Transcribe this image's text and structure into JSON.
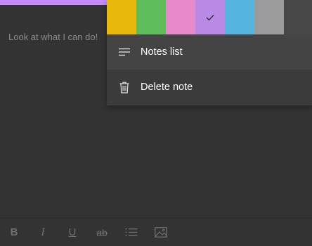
{
  "note": {
    "accent_color": "#c48bff",
    "body_text": "Look at what I can do!"
  },
  "menu": {
    "colors": [
      {
        "name": "yellow",
        "hex": "#e8b80a",
        "selected": false
      },
      {
        "name": "green",
        "hex": "#5fbd5b",
        "selected": false
      },
      {
        "name": "pink",
        "hex": "#e889c9",
        "selected": false
      },
      {
        "name": "purple",
        "hex": "#b98be6",
        "selected": true
      },
      {
        "name": "blue",
        "hex": "#55b5df",
        "selected": false
      },
      {
        "name": "gray",
        "hex": "#9b9b9b",
        "selected": false
      },
      {
        "name": "charcoal",
        "hex": "#474747",
        "selected": false
      }
    ],
    "items": [
      {
        "label": "Notes list",
        "icon": "notes-list-icon"
      },
      {
        "label": "Delete note",
        "icon": "trash-icon"
      }
    ]
  },
  "toolbar": {
    "bold": "B",
    "italic": "I",
    "underline": "U",
    "strikethrough": "ab",
    "icons": [
      "bold-icon",
      "italic-icon",
      "underline-icon",
      "strikethrough-icon",
      "bulleted-list-icon",
      "image-icon"
    ]
  }
}
